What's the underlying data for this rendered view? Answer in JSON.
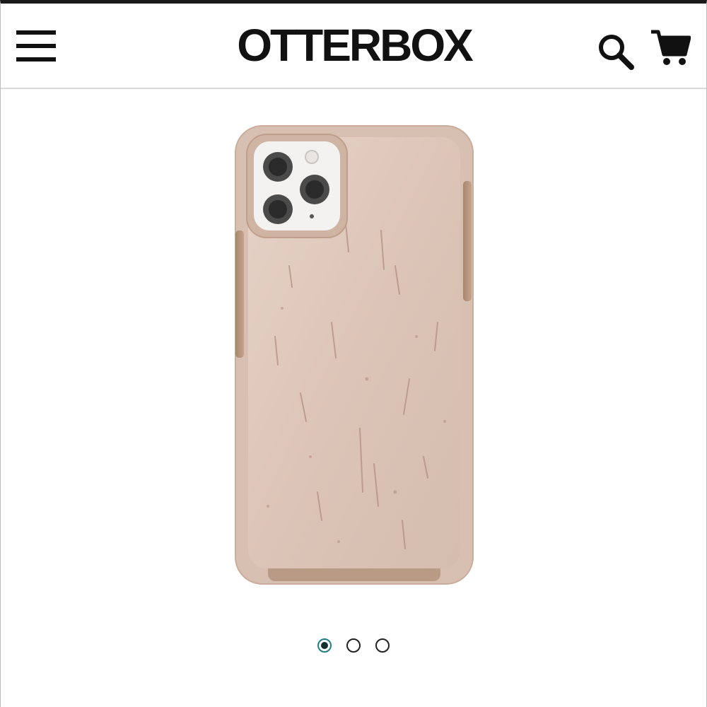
{
  "header": {
    "brand": "OTTERBOX",
    "menu_icon": "hamburger-menu-icon",
    "search_icon": "search-icon",
    "cart_icon": "shopping-cart-icon"
  },
  "product": {
    "image_icon": "phone-case-product-image",
    "case_color": "#d9c2b4",
    "accent_color": "#b59078"
  },
  "carousel": {
    "slide_count": 3,
    "active_index": 0,
    "active_color": "#1f7f86"
  }
}
